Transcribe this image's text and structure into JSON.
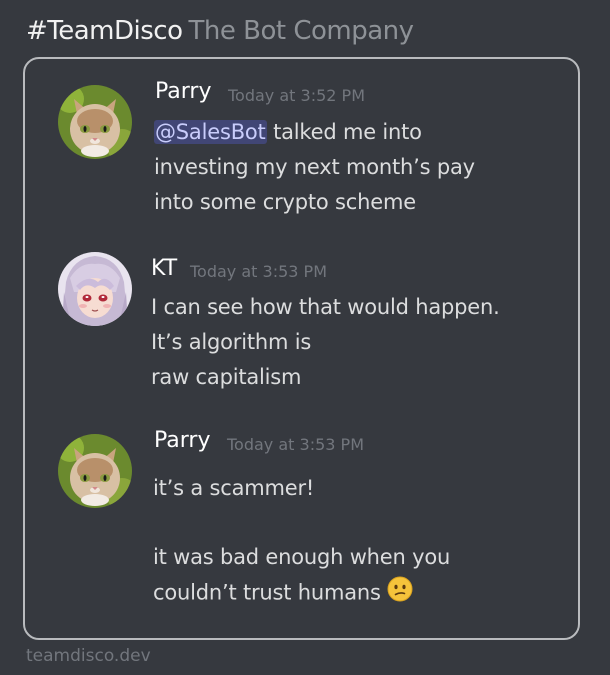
{
  "header": {
    "brand": "#TeamDisco",
    "subtitle": "The Bot Company"
  },
  "messages": [
    {
      "author": "Parry",
      "timestamp": "Today at 3:52 PM",
      "avatar": "cat-avatar",
      "mention": "@SalesBot",
      "lines": [
        " talked me into",
        "investing my next month’s pay",
        "into some crypto scheme"
      ]
    },
    {
      "author": "KT",
      "timestamp": "Today at 3:53 PM",
      "avatar": "anime-girl-avatar",
      "lines": [
        "I can see how that would happen.",
        "It’s algorithm is",
        "raw capitalism"
      ]
    },
    {
      "author": "Parry",
      "timestamp": "Today at 3:53 PM",
      "avatar": "cat-avatar",
      "lines": [
        "it’s a scammer!",
        "",
        "it was bad enough when you",
        "couldn’t trust humans"
      ],
      "emoji": "confused-face-emoji"
    }
  ],
  "footer": {
    "site": "teamdisco.dev"
  },
  "colors": {
    "background": "#36393f",
    "card_border": "#b9bbbe",
    "author": "#ffffff",
    "timestamp": "#72767d",
    "message_text": "#dcddde",
    "mention_bg": "#414675",
    "mention_text": "#c9cdfb"
  }
}
